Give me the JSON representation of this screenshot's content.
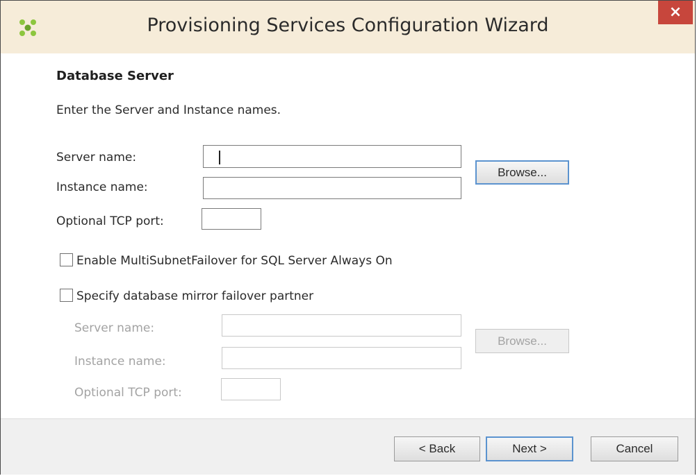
{
  "window": {
    "title": "Provisioning Services Configuration Wizard",
    "close_label": "×"
  },
  "page": {
    "heading": "Database Server",
    "description": "Enter the Server and Instance names."
  },
  "primary": {
    "server_label": "Server name:",
    "server_value": "",
    "instance_label": "Instance name:",
    "instance_value": "",
    "port_label": "Optional TCP port:",
    "port_value": "",
    "browse_label": "Browse..."
  },
  "options": {
    "multisubnet_label": "Enable MultiSubnetFailover for SQL Server Always On",
    "multisubnet_checked": false,
    "mirror_label": "Specify database mirror failover partner",
    "mirror_checked": false
  },
  "mirror": {
    "server_label": "Server name:",
    "instance_label": "Instance name:",
    "port_label": "Optional TCP port:",
    "browse_label": "Browse..."
  },
  "footer": {
    "back_label": "< Back",
    "next_label": "Next >",
    "cancel_label": "Cancel"
  },
  "colors": {
    "titlebar": "#f6ecd9",
    "close": "#c7463c",
    "focus_border": "#5b93cf",
    "icon_green": "#8dc63f"
  },
  "icons": {
    "app": "citrix-app-icon",
    "close": "close-icon"
  }
}
